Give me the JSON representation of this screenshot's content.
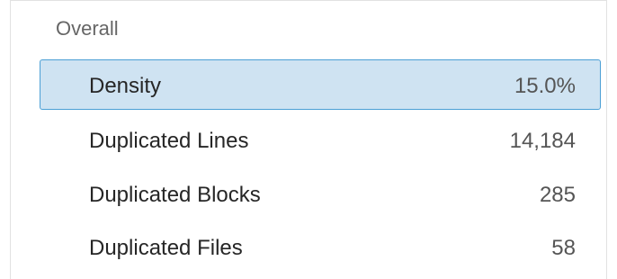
{
  "section": {
    "title": "Overall"
  },
  "metrics": [
    {
      "label": "Density",
      "value": "15.0%",
      "selected": true
    },
    {
      "label": "Duplicated Lines",
      "value": "14,184",
      "selected": false
    },
    {
      "label": "Duplicated Blocks",
      "value": "285",
      "selected": false
    },
    {
      "label": "Duplicated Files",
      "value": "58",
      "selected": false
    }
  ],
  "colors": {
    "selected_bg": "#cfe3f2",
    "selected_border": "#4b9fd5"
  }
}
